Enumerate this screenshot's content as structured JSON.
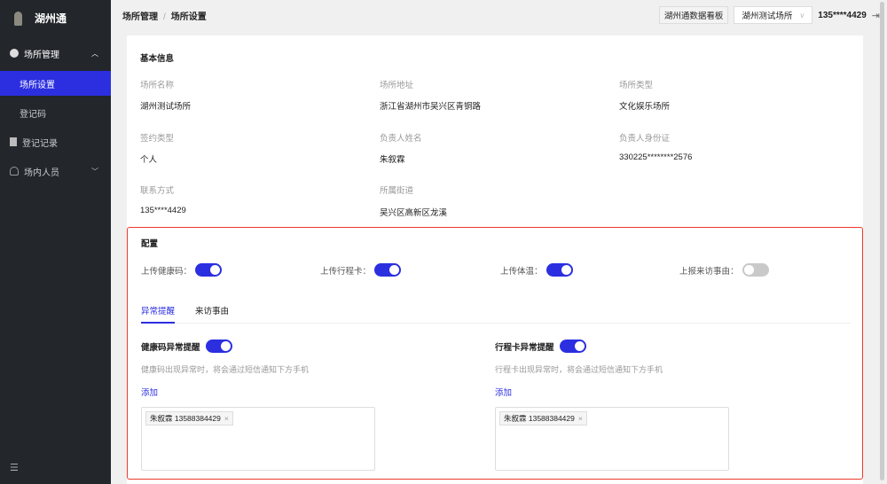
{
  "app": {
    "title": "湖州通"
  },
  "sidebar": {
    "items": [
      {
        "label": "场所管理",
        "expanded": true
      },
      {
        "label": "场所设置",
        "active": true
      },
      {
        "label": "登记码"
      },
      {
        "label": "登记记录"
      },
      {
        "label": "场内人员"
      }
    ]
  },
  "header": {
    "breadcrumb": [
      "场所管理",
      "场所设置"
    ],
    "dashboard_button": "湖州通数据看板",
    "venue_select": "湖州测试场所",
    "user": "135****4429"
  },
  "basic": {
    "title": "基本信息",
    "fields": [
      {
        "label": "场所名称",
        "value": "湖州测试场所"
      },
      {
        "label": "场所地址",
        "value": "浙江省湖州市吴兴区青铜路"
      },
      {
        "label": "场所类型",
        "value": "文化娱乐场所"
      },
      {
        "label": "签约类型",
        "value": "个人"
      },
      {
        "label": "负责人姓名",
        "value": "朱叙霖"
      },
      {
        "label": "负责人身份证",
        "value": "330225********2576"
      },
      {
        "label": "联系方式",
        "value": "135****4429"
      },
      {
        "label": "所属街道",
        "value": "吴兴区高新区龙溪"
      }
    ]
  },
  "config": {
    "title": "配置",
    "toggles": [
      {
        "label": "上传健康码：",
        "on": true
      },
      {
        "label": "上传行程卡：",
        "on": true
      },
      {
        "label": "上传体温：",
        "on": true
      },
      {
        "label": "上报来访事由：",
        "on": false
      }
    ],
    "tabs": [
      "异常提醒",
      "来访事由"
    ],
    "alerts": [
      {
        "title": "健康码异常提醒",
        "on": true,
        "desc": "健康码出现异常时，将会通过短信通知下方手机",
        "add": "添加",
        "tags": [
          "朱叙霖 13588384429"
        ]
      },
      {
        "title": "行程卡异常提醒",
        "on": true,
        "desc": "行程卡出现异常时，将会通过短信通知下方手机",
        "add": "添加",
        "tags": [
          "朱叙霖 13588384429"
        ]
      }
    ]
  },
  "colors": {
    "accent": "#2b2fe0",
    "sidebar": "#23262b",
    "highlight": "#ee3b2b"
  }
}
